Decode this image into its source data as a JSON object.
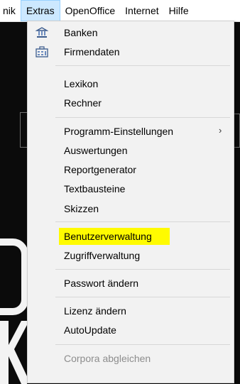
{
  "menubar": {
    "items": [
      {
        "label": "nik"
      },
      {
        "label": "Extras"
      },
      {
        "label": "OpenOffice"
      },
      {
        "label": "Internet"
      },
      {
        "label": "Hilfe"
      }
    ]
  },
  "dropdown": {
    "items": [
      {
        "label": "Banken",
        "icon": "bank-icon"
      },
      {
        "label": "Firmendaten",
        "icon": "company-data-icon"
      },
      {
        "label": "Lexikon"
      },
      {
        "label": "Rechner"
      },
      {
        "label": "Programm-Einstellungen",
        "submenu_glyph": "›"
      },
      {
        "label": "Auswertungen"
      },
      {
        "label": "Reportgenerator"
      },
      {
        "label": "Textbausteine"
      },
      {
        "label": "Skizzen"
      },
      {
        "label": "Benutzerverwaltung",
        "highlight_color": "#fffb00"
      },
      {
        "label": "Zugriffverwaltung"
      },
      {
        "label": "Passwort ändern"
      },
      {
        "label": "Lizenz ändern"
      },
      {
        "label": "AutoUpdate"
      },
      {
        "label": "Corpora abgleichen",
        "disabled": true
      }
    ]
  },
  "colors": {
    "menu_bg": "#f2f2f2",
    "active_menu_bg": "#cce8ff",
    "highlight": "#fffb00",
    "disabled_text": "#8d8d8d",
    "background": "#0b0b0b"
  }
}
